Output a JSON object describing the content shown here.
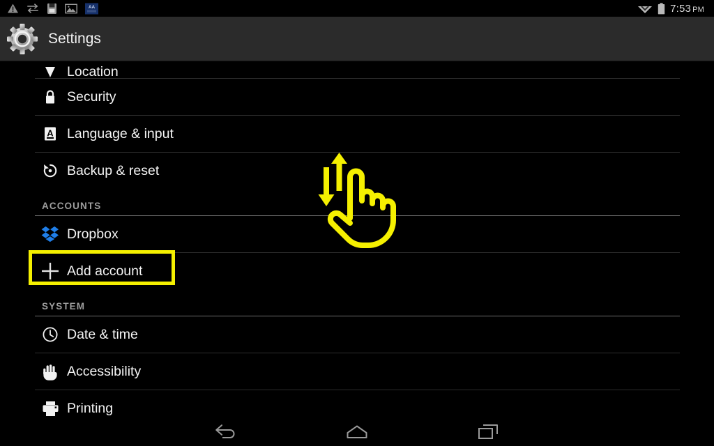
{
  "statusbar": {
    "left_icons": [
      {
        "name": "warning-triangle-icon",
        "label": "warning"
      },
      {
        "name": "data-transfer-icon",
        "label": "data transfer"
      },
      {
        "name": "sd-card-save-icon",
        "label": "save to storage"
      },
      {
        "name": "image-icon",
        "label": "screenshot"
      },
      {
        "name": "app-notification-icon",
        "label": "AA app"
      }
    ],
    "wifi_icon": "wifi-icon",
    "battery_icon": "battery-icon",
    "time": "7:53",
    "ampm": "PM"
  },
  "actionbar": {
    "icon": "settings-gear-icon",
    "title": "Settings"
  },
  "list": [
    {
      "type": "item",
      "name": "location",
      "icon": "location-pin-icon",
      "label": "Location",
      "clipped": true
    },
    {
      "type": "item",
      "name": "security",
      "icon": "lock-icon",
      "label": "Security"
    },
    {
      "type": "item",
      "name": "language-input",
      "icon": "keyboard-a-icon",
      "label": "Language & input"
    },
    {
      "type": "item",
      "name": "backup-reset",
      "icon": "backup-restore-icon",
      "label": "Backup & reset"
    },
    {
      "type": "header",
      "name": "accounts",
      "label": "ACCOUNTS"
    },
    {
      "type": "item",
      "name": "dropbox",
      "icon": "dropbox-icon",
      "label": "Dropbox"
    },
    {
      "type": "item",
      "name": "add-account",
      "icon": "plus-icon",
      "label": "Add account",
      "highlighted": true
    },
    {
      "type": "header",
      "name": "system",
      "label": "SYSTEM"
    },
    {
      "type": "item",
      "name": "date-time",
      "icon": "clock-icon",
      "label": "Date & time"
    },
    {
      "type": "item",
      "name": "accessibility",
      "icon": "hand-icon",
      "label": "Accessibility"
    },
    {
      "type": "item",
      "name": "printing",
      "icon": "printer-icon",
      "label": "Printing"
    }
  ],
  "gesture": {
    "name": "scroll-vertical-gesture",
    "description": "hand with pointing finger and up/down arrows indicating vertical scroll",
    "color": "#f5f000"
  },
  "navbar": {
    "back": "back-icon",
    "home": "home-icon",
    "recents": "recent-apps-icon"
  },
  "colors": {
    "highlight": "#f5f000",
    "background": "#000000",
    "actionbar": "#2b2b2b",
    "text": "#f4f4f4",
    "section_text": "#9e9e9e",
    "dropbox_blue": "#1f7ee8"
  }
}
